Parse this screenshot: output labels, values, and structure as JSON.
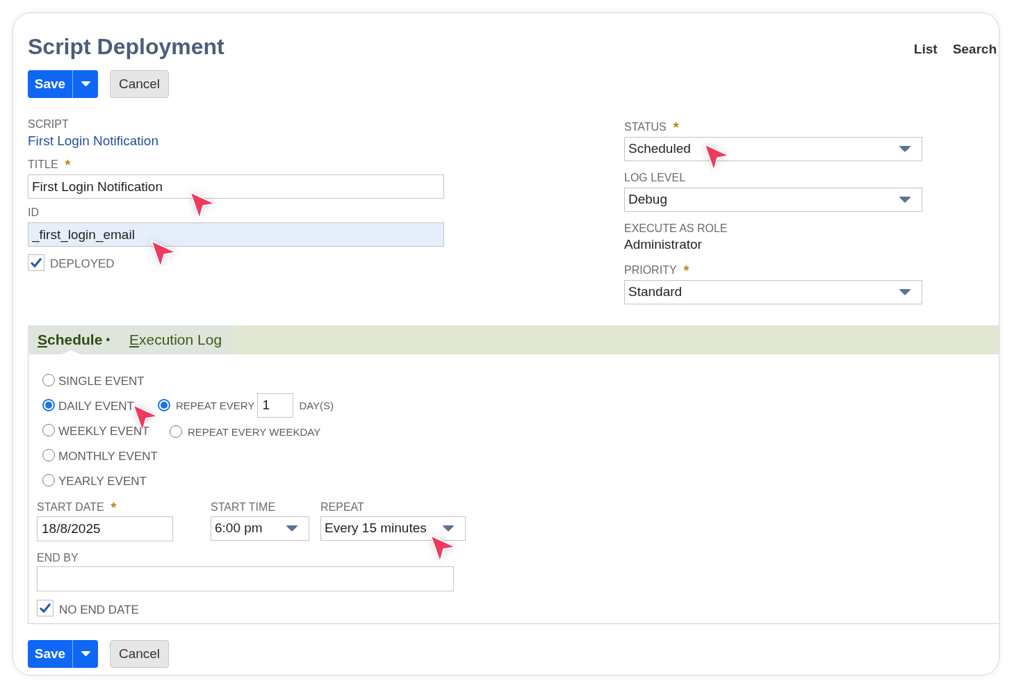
{
  "title": "Script Deployment",
  "nav_links": [
    "List",
    "Search"
  ],
  "toolbars": [
    {
      "save": "Save",
      "cancel": "Cancel"
    },
    {
      "save": "Save",
      "cancel": "Cancel"
    }
  ],
  "left_fields": [
    {
      "kind": "link",
      "label": "SCRIPT",
      "value": "First Login Notification"
    },
    {
      "kind": "input",
      "label": "TITLE",
      "required_mark": "*",
      "value": "First Login Notification",
      "highlighted": false
    },
    {
      "kind": "input",
      "label": "ID",
      "value": "_first_login_email",
      "highlighted": true
    },
    {
      "kind": "checkbox",
      "label": "DEPLOYED",
      "checked": true
    }
  ],
  "right_fields": [
    {
      "kind": "select",
      "label": "STATUS",
      "required_mark": "*",
      "value": "Scheduled"
    },
    {
      "kind": "select",
      "label": "LOG LEVEL",
      "value": "Debug"
    },
    {
      "kind": "readonly",
      "label": "EXECUTE AS ROLE",
      "value": "Administrator"
    },
    {
      "kind": "select",
      "label": "PRIORITY",
      "required_mark": "*",
      "value": "Standard"
    }
  ],
  "tabs": [
    {
      "label": "Schedule",
      "marker": "•",
      "selected": true
    },
    {
      "label": "Execution Log",
      "selected": false
    }
  ],
  "schedule": {
    "event_types": [
      {
        "label": "SINGLE EVENT",
        "selected": false
      },
      {
        "label": "DAILY EVENT",
        "selected": true
      },
      {
        "label": "WEEKLY EVENT",
        "selected": false
      },
      {
        "label": "MONTHLY EVENT",
        "selected": false
      },
      {
        "label": "YEARLY EVENT",
        "selected": false
      }
    ],
    "daily_options": [
      {
        "kind": "interval",
        "label": "REPEAT EVERY",
        "value": "1",
        "unit": "DAY(S)",
        "selected": true
      },
      {
        "kind": "weekday",
        "label": "REPEAT EVERY WEEKDAY",
        "selected": false
      }
    ],
    "start_date": {
      "label": "START DATE",
      "required_mark": "*",
      "value": "18/8/2025"
    },
    "start_time": {
      "label": "START TIME",
      "value": "6:00 pm"
    },
    "repeat": {
      "label": "REPEAT",
      "value": "Every 15 minutes"
    },
    "end_by": {
      "label": "END BY"
    },
    "no_end_date": {
      "label": "NO END DATE",
      "checked": true
    }
  }
}
